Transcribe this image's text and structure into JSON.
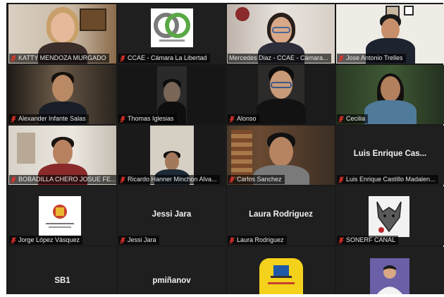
{
  "participants": [
    {
      "name": "KATTY MENDOZA MURGADO"
    },
    {
      "name": "CCAE - Cámara La Libertad"
    },
    {
      "name": "Mercedes Diaz - CCAE - Cámara..."
    },
    {
      "name": "Jose Antonio Trelles"
    },
    {
      "name": "Alexander Infante Salas"
    },
    {
      "name": "Thomas Iglesias"
    },
    {
      "name": "Alonso"
    },
    {
      "name": "Cecilia"
    },
    {
      "name": "BOBADILLA CHERO JOSUE FE..."
    },
    {
      "name": "Ricardo Hanner Minchon Alva..."
    },
    {
      "name": "Carlos Sanchez"
    },
    {
      "name": "Luis Enrique Castillo Madalen...",
      "display": "Luis Enrique Cas..."
    },
    {
      "name": "Jorge López Vásquez"
    },
    {
      "name": "Jessi Jara",
      "display": "Jessi Jara"
    },
    {
      "name": "Laura Rodriguez",
      "display": "Laura Rodriguez"
    },
    {
      "name": "SONERF CANAL"
    },
    {
      "display": "SB1"
    },
    {
      "display": "pmiñanov"
    }
  ],
  "colors": {
    "active_speaker_border": "#7fd36b",
    "mute_icon": "#e0322b",
    "tile_bg": "#1f1f1f"
  }
}
